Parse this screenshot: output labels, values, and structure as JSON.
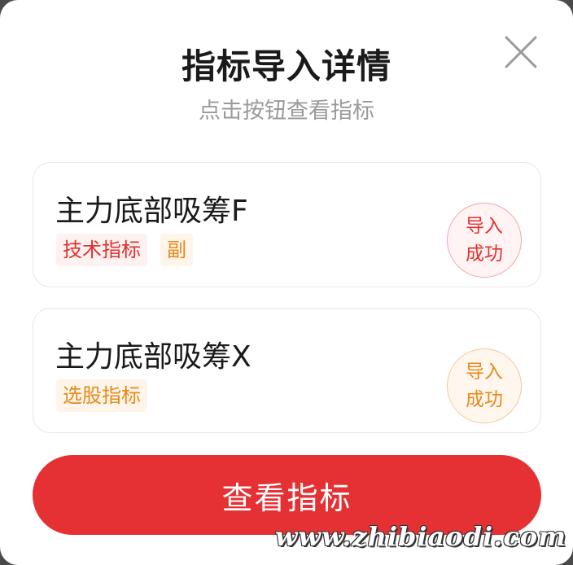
{
  "dialog": {
    "title": "指标导入详情",
    "subtitle": "点击按钮查看指标",
    "close_icon": "close-icon"
  },
  "cards": [
    {
      "name": "主力底部吸筹F",
      "tags": [
        "技术指标",
        "副"
      ],
      "status_lines": [
        "导入",
        "成功"
      ],
      "status_color": "#e0322f"
    },
    {
      "name": "主力底部吸筹X",
      "tags": [
        "选股指标"
      ],
      "status_lines": [
        "导入",
        "成功"
      ],
      "status_color": "#e8891a"
    }
  ],
  "cta": {
    "label": "查看指标",
    "color": "#e53133"
  },
  "watermark": "www.zhibiaodi.com"
}
